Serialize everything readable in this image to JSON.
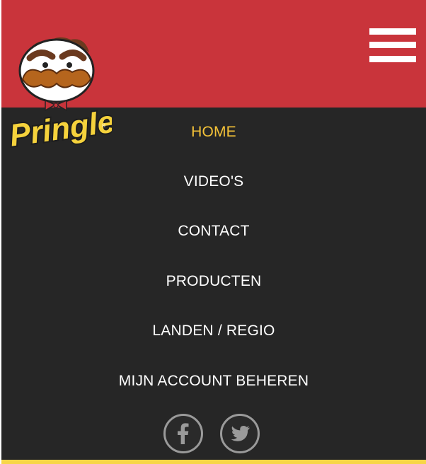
{
  "brand": {
    "logo_text": "Pringles",
    "colors": {
      "header": "#c9343b",
      "menu_bg": "#262626",
      "active": "#f5c338",
      "footer": "#f7d648"
    }
  },
  "header": {
    "menu_icon": "hamburger-menu-icon"
  },
  "nav": {
    "items": [
      {
        "label": "HOME",
        "active": true
      },
      {
        "label": "VIDEO'S",
        "active": false
      },
      {
        "label": "CONTACT",
        "active": false
      },
      {
        "label": "PRODUCTEN",
        "active": false
      },
      {
        "label": "LANDEN / REGIO",
        "active": false
      },
      {
        "label": "MIJN ACCOUNT BEHEREN",
        "active": false
      }
    ]
  },
  "social": [
    {
      "name": "facebook",
      "icon": "facebook-icon"
    },
    {
      "name": "twitter",
      "icon": "twitter-icon"
    }
  ]
}
